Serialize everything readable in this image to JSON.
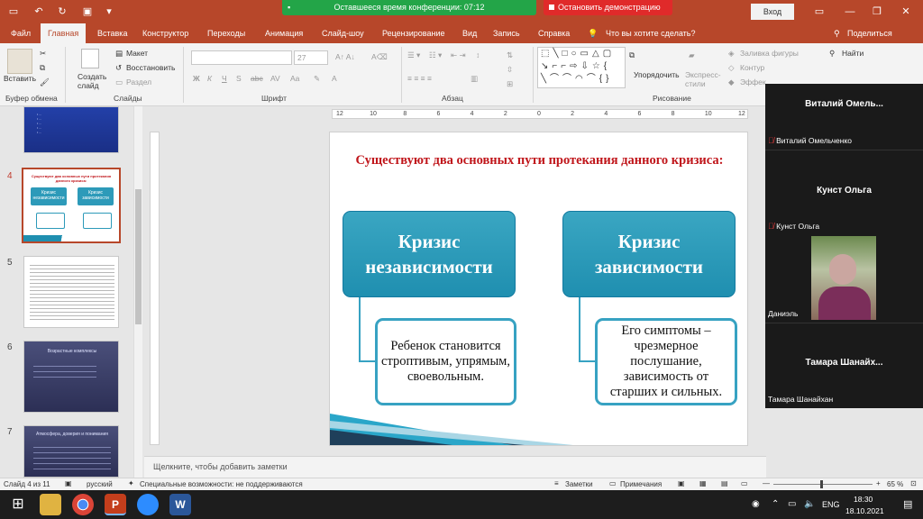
{
  "titlebar": {
    "conference_timer": "Оставшееся время конференции: 07:12",
    "stop_demo": "Остановить демонстрацию",
    "signin": "Вход"
  },
  "tabs": [
    "Файл",
    "Главная",
    "Вставка",
    "Конструктор",
    "Переходы",
    "Анимация",
    "Слайд-шоу",
    "Рецензирование",
    "Вид",
    "Запись",
    "Справка"
  ],
  "search_prompt": "Что вы хотите сделать?",
  "share": "Поделиться",
  "ribbon": {
    "paste": "Вставить",
    "clipboard": "Буфер обмена",
    "new_slide": "Создать слайд",
    "layout": "Макет",
    "reset": "Восстановить",
    "section": "Раздел",
    "slides": "Слайды",
    "font_size": "27",
    "font": "Шрифт",
    "paragraph": "Абзац",
    "arrange": "Упорядочить",
    "quick_styles": "Экспресс-стили",
    "drawing": "Рисование",
    "fill": "Заливка фигуры",
    "outline": "Контур",
    "effects": "Эффек",
    "find": "Найти"
  },
  "thumbnails": [
    {
      "num": "",
      "bullets": [
        "• ...",
        "• ...",
        "• ...",
        "• ...",
        "• ..."
      ]
    },
    {
      "num": "4",
      "title": "Существуют два основных пути протекания данного кризиса:",
      "box1": "Кризис независимости",
      "box2": "Кризис зависимости"
    },
    {
      "num": "5"
    },
    {
      "num": "6",
      "title": "Возрастные комплексы"
    },
    {
      "num": "7",
      "title": "Атмосфера, доверия и понимания"
    }
  ],
  "ruler_marks": [
    "12",
    "10",
    "8",
    "6",
    "4",
    "2",
    "0",
    "2",
    "4",
    "6",
    "8",
    "10",
    "12"
  ],
  "slide": {
    "title": "Существуют два основных пути протекания данного кризиса:",
    "left_box": "Кризис независимости",
    "right_box": "Кризис зависимости",
    "left_text": "Ребенок становится строптивым, упрямым, своевольным.",
    "right_text": "Его симптомы – чрезмерное послушание, зависимость от старших и сильных."
  },
  "notes_placeholder": "Щелкните, чтобы добавить заметки",
  "status": {
    "slide_counter": "Слайд 4 из 11",
    "language": "русский",
    "accessibility": "Специальные возможности: не поддерживаются",
    "notes": "Заметки",
    "comments": "Примечания",
    "zoom": "65 %"
  },
  "participants": [
    {
      "tile_name": "Виталий Омель...",
      "label": "Виталий Омельченко"
    },
    {
      "tile_name": "Кунст Ольга",
      "label": "Кунст Ольга"
    },
    {
      "tile_name": "",
      "label": "Даниэль"
    },
    {
      "tile_name": "Тамара Шанайх...",
      "label": "Тамара Шанайхан"
    }
  ],
  "taskbar": {
    "lang": "ENG",
    "time": "18:30",
    "date": "18.10.2021"
  }
}
